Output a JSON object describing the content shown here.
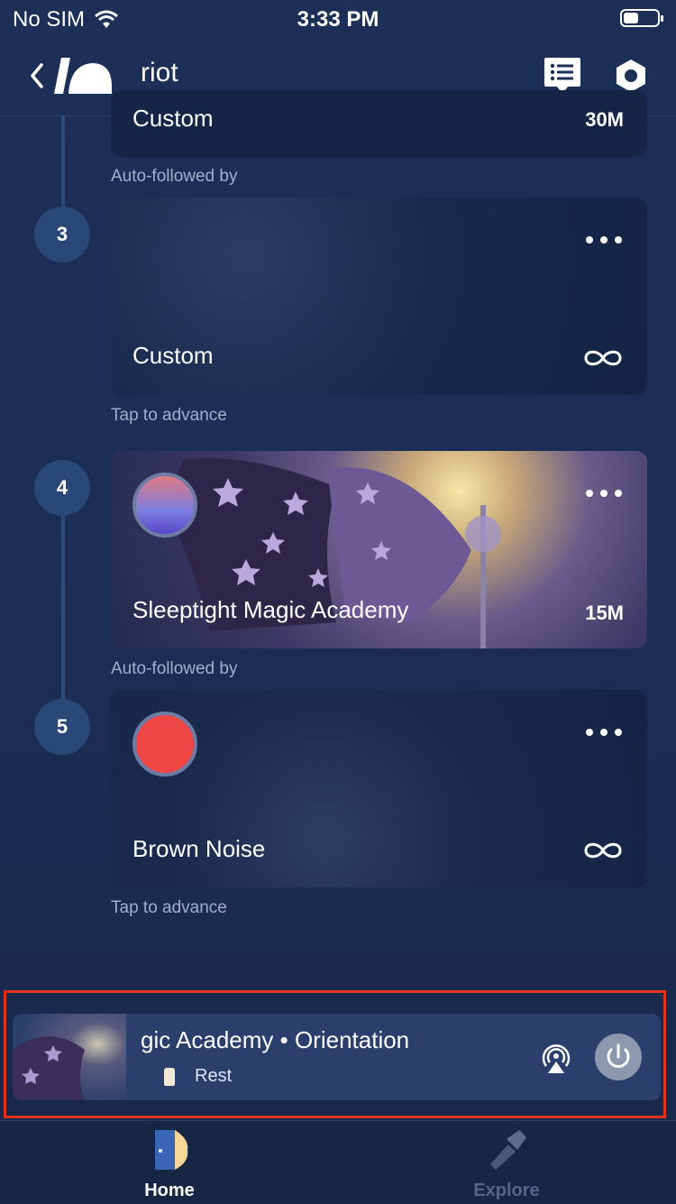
{
  "status": {
    "carrier": "No SIM",
    "time": "3:33 PM"
  },
  "nav": {
    "title": "riot"
  },
  "steps": [
    {
      "number": "3",
      "card_title": "Custom",
      "prev_duration": "30M",
      "prev_title": "Custom",
      "label_above": "Auto-followed by",
      "label_below": "Tap to advance",
      "end": "infinity"
    },
    {
      "number": "4",
      "card_title": "Sleeptight Magic Academy",
      "duration": "15M",
      "label_below": "Auto-followed by"
    },
    {
      "number": "5",
      "card_title": "Brown Noise",
      "label_below": "Tap to advance",
      "end": "infinity"
    }
  ],
  "mini_player": {
    "title": "gic Academy • Orientation",
    "subtitle": "Rest"
  },
  "tabs": [
    {
      "label": "Home",
      "active": true
    },
    {
      "label": "Explore",
      "active": false
    }
  ],
  "colors": {
    "background": "#1c2f57",
    "card": "#132444",
    "step_circle": "#294877",
    "highlight": "#e0321c",
    "brown_noise_dot": "#f04646"
  },
  "icons": [
    "back-chevron-icon",
    "logo-icon",
    "chat-list-icon",
    "settings-icon",
    "more-dots-icon",
    "infinity-icon",
    "airplay-icon",
    "power-icon",
    "home-door-icon",
    "explore-flashlight-icon"
  ]
}
